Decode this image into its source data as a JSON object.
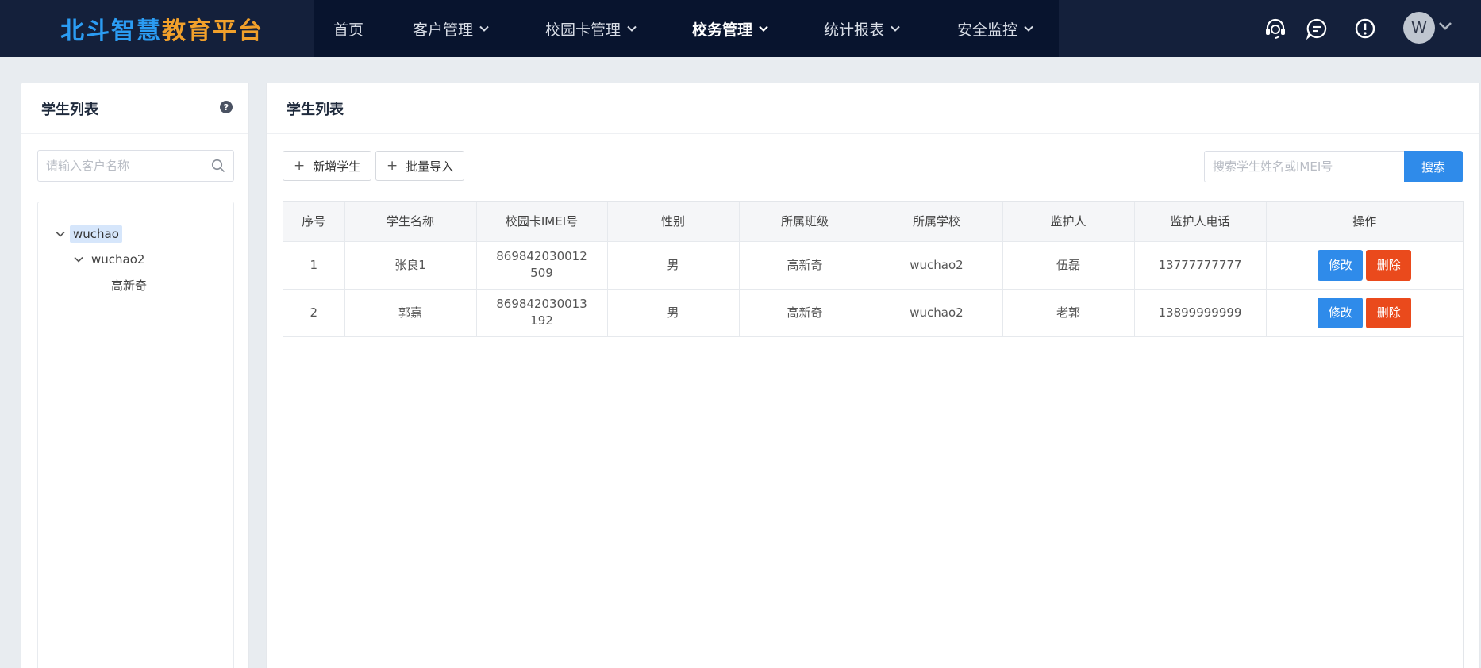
{
  "brand": {
    "part1": "北斗",
    "part2": "智慧",
    "part3": "教育平台"
  },
  "nav": {
    "items": [
      {
        "label": "首页",
        "has_caret": false,
        "active": false
      },
      {
        "label": "客户管理",
        "has_caret": true,
        "active": false
      },
      {
        "label": "校园卡管理",
        "has_caret": true,
        "active": false
      },
      {
        "label": "校务管理",
        "has_caret": true,
        "active": true
      },
      {
        "label": "统计报表",
        "has_caret": true,
        "active": false
      },
      {
        "label": "安全监控",
        "has_caret": true,
        "active": false
      }
    ]
  },
  "header_icons": [
    "headset-icon",
    "chat-icon",
    "alert-icon"
  ],
  "user": {
    "initial": "W"
  },
  "left_panel": {
    "title": "学生列表",
    "search_placeholder": "请输入客户名称",
    "tree": [
      {
        "label": "wuchao",
        "level": 0,
        "expanded": true,
        "selected": true
      },
      {
        "label": "wuchao2",
        "level": 1,
        "expanded": true,
        "selected": false
      },
      {
        "label": "高新奇",
        "level": 2,
        "expanded": false,
        "selected": false
      }
    ]
  },
  "main_panel": {
    "title": "学生列表",
    "add_button": "新增学生",
    "import_button": "批量导入",
    "search_placeholder": "搜索学生姓名或IMEI号",
    "search_button": "搜索",
    "columns": [
      "序号",
      "学生名称",
      "校园卡IMEI号",
      "性别",
      "所属班级",
      "所属学校",
      "监护人",
      "监护人电话",
      "操作"
    ],
    "rows": [
      {
        "index": "1",
        "name": "张良1",
        "imei": "869842030012509",
        "gender": "男",
        "class": "高新奇",
        "school": "wuchao2",
        "guardian": "伍磊",
        "phone": "13777777777"
      },
      {
        "index": "2",
        "name": "郭嘉",
        "imei": "869842030013192",
        "gender": "男",
        "class": "高新奇",
        "school": "wuchao2",
        "guardian": "老郭",
        "phone": "13899999999"
      }
    ],
    "edit_label": "修改",
    "delete_label": "删除"
  },
  "colors": {
    "topbar": "#14203b",
    "nav_bg": "#08142e",
    "primary": "#2f8bea",
    "danger": "#ea4a1c",
    "logo_blue": "#2b9cf3",
    "logo_orange": "#f1a02b"
  }
}
